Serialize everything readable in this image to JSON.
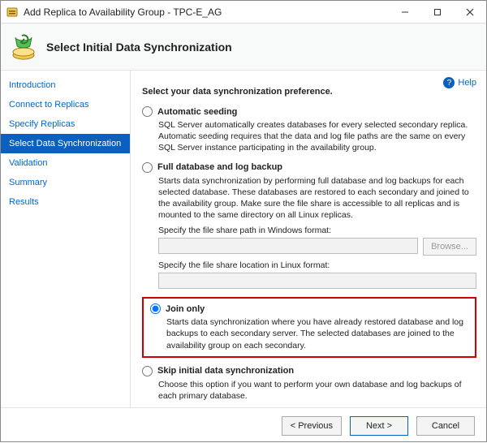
{
  "window": {
    "title": "Add Replica to Availability Group - TPC-E_AG"
  },
  "header": {
    "title": "Select Initial Data Synchronization"
  },
  "help_label": "Help",
  "sidebar": {
    "items": [
      {
        "label": "Introduction"
      },
      {
        "label": "Connect to Replicas"
      },
      {
        "label": "Specify Replicas"
      },
      {
        "label": "Select Data Synchronization"
      },
      {
        "label": "Validation"
      },
      {
        "label": "Summary"
      },
      {
        "label": "Results"
      }
    ],
    "selected_index": 3
  },
  "content": {
    "heading": "Select your data synchronization preference.",
    "options": [
      {
        "id": "automatic-seeding",
        "label": "Automatic seeding",
        "desc": "SQL Server automatically creates databases for every selected secondary replica. Automatic seeding requires that the data and log file paths are the same on every SQL Server instance participating in the availability group."
      },
      {
        "id": "full-db-log-backup",
        "label": "Full database and log backup",
        "desc": "Starts data synchronization by performing full database and log backups for each selected database. These databases are restored to each secondary and joined to the availability group. Make sure the file share is accessible to all replicas and is mounted to the same directory on all Linux replicas.",
        "win_share_label": "Specify the file share path in Windows format:",
        "win_share_value": "",
        "browse_label": "Browse...",
        "linux_share_label": "Specify the file share location in Linux format:",
        "linux_share_value": ""
      },
      {
        "id": "join-only",
        "label": "Join only",
        "desc": "Starts data synchronization where you have already restored database and log backups to each secondary server. The selected databases are joined to the availability group on each secondary."
      },
      {
        "id": "skip-sync",
        "label": "Skip initial data synchronization",
        "desc": "Choose this option if you want to perform your own database and log backups of each primary database."
      }
    ],
    "selected_option": "join-only"
  },
  "footer": {
    "previous": "< Previous",
    "next": "Next >",
    "cancel": "Cancel"
  }
}
